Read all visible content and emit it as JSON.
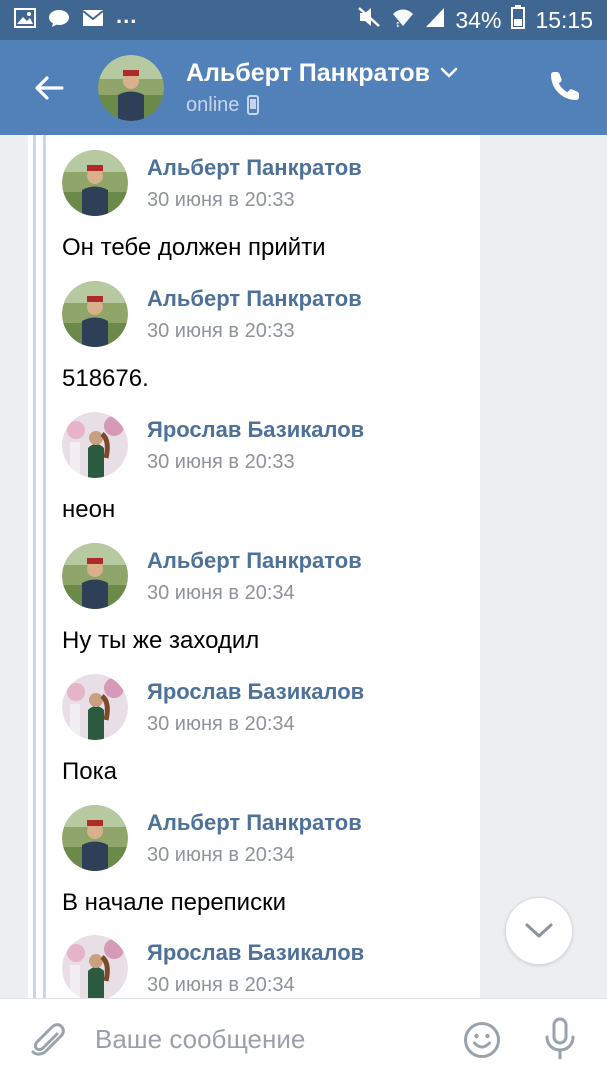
{
  "status_bar": {
    "dots": "...",
    "battery": "34%",
    "time": "15:15",
    "icons": [
      "image-icon",
      "chat-bubble-icon",
      "mail-icon",
      "mute-icon",
      "wifi-icon",
      "signal-icon",
      "battery-icon"
    ]
  },
  "header": {
    "name": "Альберт Панкратов",
    "status": "online",
    "icons": [
      "back-arrow-icon",
      "chevron-down-icon",
      "mobile-device-icon",
      "phone-icon"
    ]
  },
  "messages": [
    {
      "author": "Альберт Панкратов",
      "date": "30 июня в 20:33",
      "text": "Он тебе должен прийти"
    },
    {
      "author": "Альберт Панкратов",
      "date": "30 июня в 20:33",
      "text": "518676."
    },
    {
      "author": "Ярослав Базикалов",
      "date": "30 июня в 20:33",
      "text": "неон"
    },
    {
      "author": "Альберт Панкратов",
      "date": "30 июня в 20:34",
      "text": "Ну ты же заходил"
    },
    {
      "author": "Ярослав Базикалов",
      "date": "30 июня в 20:34",
      "text": "Пока"
    },
    {
      "author": "Альберт Панкратов",
      "date": "30 июня в 20:34",
      "text": "В начале переписки"
    },
    {
      "author": "Ярослав Базикалов",
      "date": "30 июня в 20:34",
      "text": ""
    }
  ],
  "input": {
    "placeholder": "Ваше сообщение",
    "value": ""
  },
  "colors": {
    "status_bar": "#3f6792",
    "header": "#5181b8",
    "author": "#4d7198",
    "date": "#8e9299",
    "background": "#edeef0"
  }
}
